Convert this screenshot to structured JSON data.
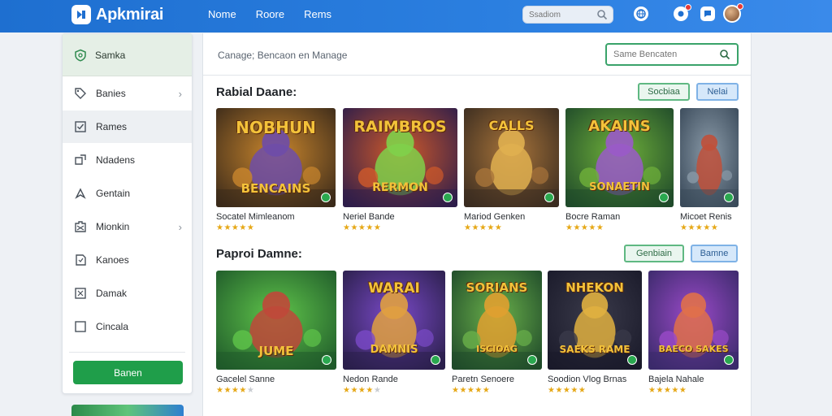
{
  "app": {
    "title": "Apkmirai"
  },
  "nav": [
    {
      "label": "Nome"
    },
    {
      "label": "Roore"
    },
    {
      "label": "Rems"
    }
  ],
  "search": {
    "placeholder": "Ssadiom"
  },
  "sidebar": {
    "header": {
      "label": "Samka",
      "icon": "shield-icon"
    },
    "items": [
      {
        "label": "Banies",
        "icon": "tag-icon",
        "chevron": true
      },
      {
        "label": "Rames",
        "icon": "checkbox-icon",
        "chevron": false
      },
      {
        "label": "Ndadens",
        "icon": "share-icon",
        "chevron": false
      },
      {
        "label": "Gentain",
        "icon": "arrow-up-icon",
        "chevron": false
      },
      {
        "label": "Mionkin",
        "icon": "puzzle-icon",
        "chevron": true
      },
      {
        "label": "Kanoes",
        "icon": "note-icon",
        "chevron": false
      },
      {
        "label": "Damak",
        "icon": "cross-box-icon",
        "chevron": false
      },
      {
        "label": "Cincala",
        "icon": "square-icon",
        "chevron": false
      }
    ],
    "button": {
      "label": "Banen"
    }
  },
  "main": {
    "breadcrumb": "Canage;  Bencaon en Manage",
    "search_placeholder": "Same Bencaten",
    "sections": [
      {
        "title": "Rabial Daane:",
        "buttons": [
          "Socbiaa",
          "Nelai"
        ],
        "cards": [
          {
            "name": "Socatel Mimleanom",
            "title": "NOBHUN",
            "sub": "BENCAINS",
            "rating": 5,
            "colors": [
              "#3b2a1a",
              "#c9862d",
              "#6e4da8"
            ]
          },
          {
            "name": "Neriel Bande",
            "title": "RAIMBROS",
            "sub": "RERMON",
            "rating": 5,
            "colors": [
              "#2e1d4a",
              "#d05a2a",
              "#7fd04a"
            ]
          },
          {
            "name": "Mariod Genken",
            "title": "CALLS",
            "sub": "",
            "rating": 5,
            "colors": [
              "#3a2c20",
              "#a8743a",
              "#e0b050"
            ]
          },
          {
            "name": "Bocre Raman",
            "title": "AKAINS",
            "sub": "SONAETIN",
            "rating": 5,
            "colors": [
              "#1f4a2a",
              "#6fb03a",
              "#9a5ac8"
            ]
          },
          {
            "name": "Micoet Renis",
            "title": "",
            "sub": "",
            "rating": 5,
            "colors": [
              "#3a4a5a",
              "#8a9aa8",
              "#c0503a"
            ]
          }
        ]
      },
      {
        "title": "Paproi Damne:",
        "buttons": [
          "Genbiain",
          "Bamne"
        ],
        "cards": [
          {
            "name": "Gacelel Sanne",
            "title": "",
            "sub": "JUME",
            "rating": 4,
            "colors": [
              "#1f5a2a",
              "#5fc44a",
              "#c0483a"
            ]
          },
          {
            "name": "Nedon Rande",
            "title": "WARAI",
            "sub": "DAMNIS",
            "rating": 4,
            "colors": [
              "#2a1f4a",
              "#7a4ac8",
              "#e0a040"
            ]
          },
          {
            "name": "Paretn Senoere",
            "title": "SORIANS",
            "sub": "ISCIOAG",
            "rating": 5,
            "colors": [
              "#1f4a2a",
              "#6ab04a",
              "#e0a030"
            ]
          },
          {
            "name": "Soodion Vlog Brnas",
            "title": "NHEKON",
            "sub": "SAEKS RAME",
            "rating": 5,
            "colors": [
              "#1a1a2a",
              "#3a3a4a",
              "#e0b040"
            ]
          },
          {
            "name": "Bajela Nahale",
            "title": "",
            "sub": "BAECO SAKES",
            "rating": 5,
            "colors": [
              "#3a2a6a",
              "#9a4ac8",
              "#e0704a"
            ]
          }
        ]
      }
    ]
  },
  "colors": {
    "topbar": "#1e6fd0",
    "accent_green": "#1f9e4a",
    "star": "#e6a817"
  }
}
